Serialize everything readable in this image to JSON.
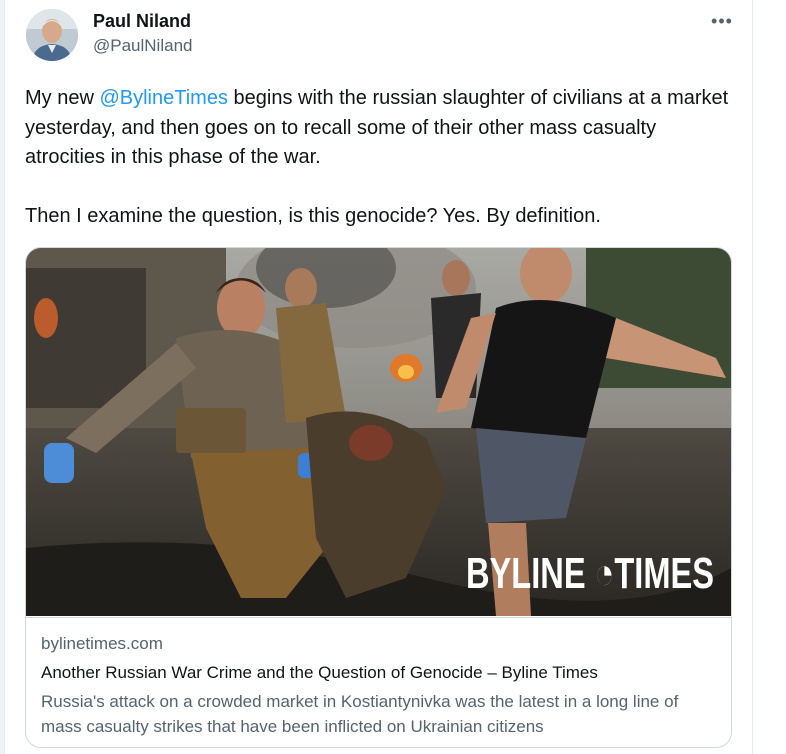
{
  "author": {
    "name": "Paul Niland",
    "handle": "@PaulNiland"
  },
  "menu": {
    "icon": "more-horizontal-icon",
    "glyph": "•••"
  },
  "tweet": {
    "line1_prefix": "My new ",
    "mention": "@BylineTimes",
    "line1_suffix": " begins with the russian slaughter of civilians at a market yesterday, and then goes on to recall some of their other mass casualty atrocities in this phase of the war.",
    "paragraph2": "Then I examine the question, is this genocide? Yes. By definition."
  },
  "card": {
    "watermark": "BYLINE TIMES",
    "domain": "bylinetimes.com",
    "title": "Another Russian War Crime and the Question of Genocide – Byline Times",
    "description": "Russia's attack on a crowded market in Kostiantynivka was the latest in a long line of mass casualty strikes that have been inflicted on Ukrainian citizens"
  },
  "colors": {
    "link": "#1d9bf0",
    "text": "#0f1419",
    "secondary": "#536471",
    "border": "#cfd9de"
  }
}
